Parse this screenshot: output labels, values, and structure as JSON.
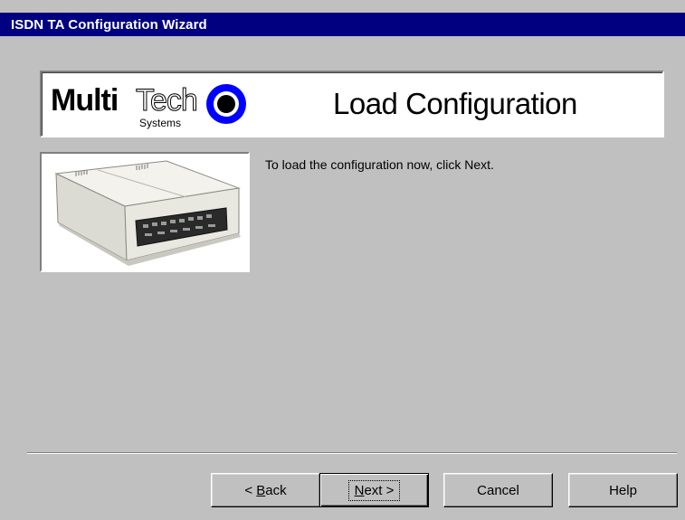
{
  "window": {
    "title": "ISDN TA Configuration Wizard"
  },
  "banner": {
    "logo_multi": "Multi",
    "logo_tech": "Tech",
    "logo_systems": "Systems",
    "title": "Load Configuration"
  },
  "content": {
    "instruction": "To load the configuration now, click Next."
  },
  "buttons": {
    "back": {
      "label_pre": "< ",
      "accel": "B",
      "label_post": "ack"
    },
    "next": {
      "accel": "N",
      "label_post": "ext >"
    },
    "cancel": {
      "label": "Cancel"
    },
    "help": {
      "label": "Help"
    }
  },
  "colors": {
    "title_bar": "#000080",
    "dialog_bg": "#c0c0c0",
    "logo_blue": "#0000ff"
  },
  "icons": {
    "logo_mark": "multitech-ring-icon",
    "product": "isdn-terminal-adapter-image"
  }
}
